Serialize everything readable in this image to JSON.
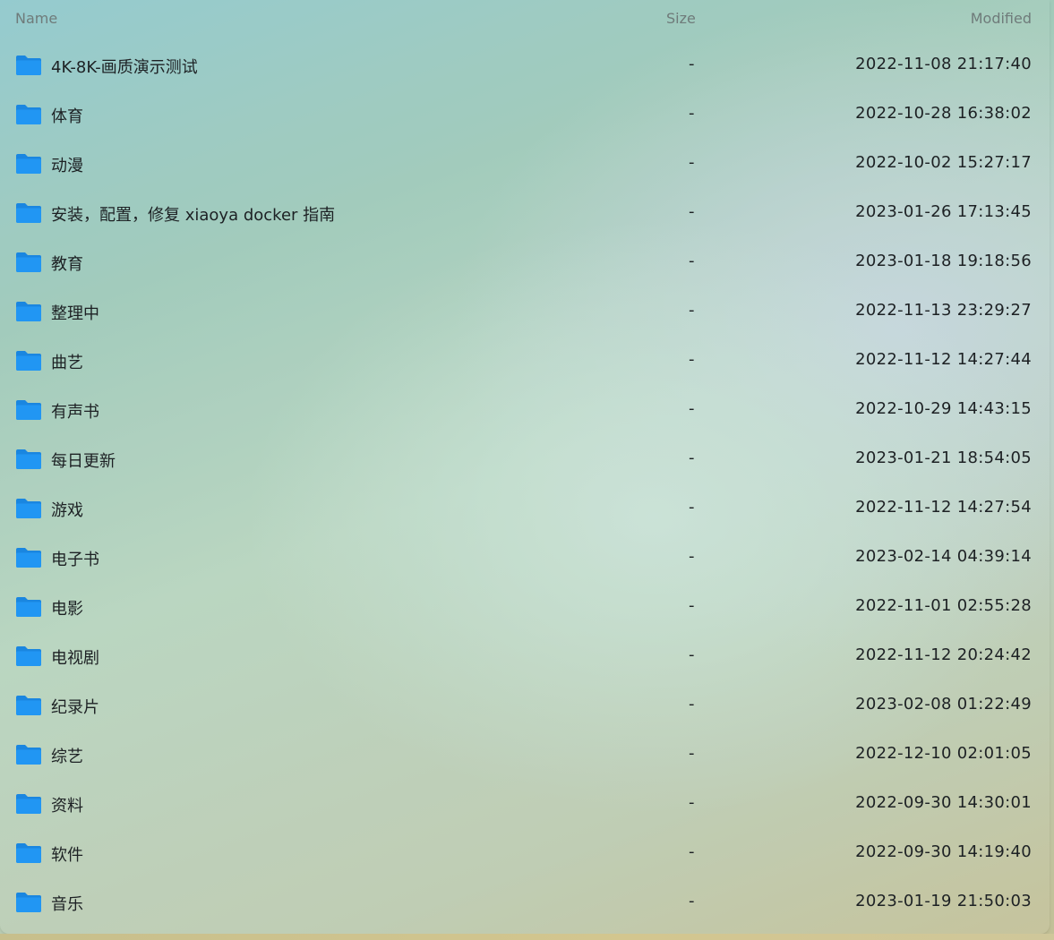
{
  "header": {
    "name_label": "Name",
    "size_label": "Size",
    "modified_label": "Modified"
  },
  "colors": {
    "folder": "#2196f3",
    "folder_tab": "#1a86e0",
    "text": "#1d2124",
    "header_text": "#6f7b7a"
  },
  "icons": {
    "folder": "folder-icon"
  },
  "rows": [
    {
      "name": "4K-8K-画质演示测试",
      "size": "-",
      "modified": "2022-11-08 21:17:40"
    },
    {
      "name": "体育",
      "size": "-",
      "modified": "2022-10-28 16:38:02"
    },
    {
      "name": "动漫",
      "size": "-",
      "modified": "2022-10-02 15:27:17"
    },
    {
      "name": "安装，配置，修复 xiaoya docker 指南",
      "size": "-",
      "modified": "2023-01-26 17:13:45"
    },
    {
      "name": "教育",
      "size": "-",
      "modified": "2023-01-18 19:18:56"
    },
    {
      "name": "整理中",
      "size": "-",
      "modified": "2022-11-13 23:29:27"
    },
    {
      "name": "曲艺",
      "size": "-",
      "modified": "2022-11-12 14:27:44"
    },
    {
      "name": "有声书",
      "size": "-",
      "modified": "2022-10-29 14:43:15"
    },
    {
      "name": "每日更新",
      "size": "-",
      "modified": "2023-01-21 18:54:05"
    },
    {
      "name": "游戏",
      "size": "-",
      "modified": "2022-11-12 14:27:54"
    },
    {
      "name": "电子书",
      "size": "-",
      "modified": "2023-02-14 04:39:14"
    },
    {
      "name": "电影",
      "size": "-",
      "modified": "2022-11-01 02:55:28"
    },
    {
      "name": "电视剧",
      "size": "-",
      "modified": "2022-11-12 20:24:42"
    },
    {
      "name": "纪录片",
      "size": "-",
      "modified": "2023-02-08 01:22:49"
    },
    {
      "name": "综艺",
      "size": "-",
      "modified": "2022-12-10 02:01:05"
    },
    {
      "name": "资料",
      "size": "-",
      "modified": "2022-09-30 14:30:01"
    },
    {
      "name": "软件",
      "size": "-",
      "modified": "2022-09-30 14:19:40"
    },
    {
      "name": "音乐",
      "size": "-",
      "modified": "2023-01-19 21:50:03"
    }
  ]
}
